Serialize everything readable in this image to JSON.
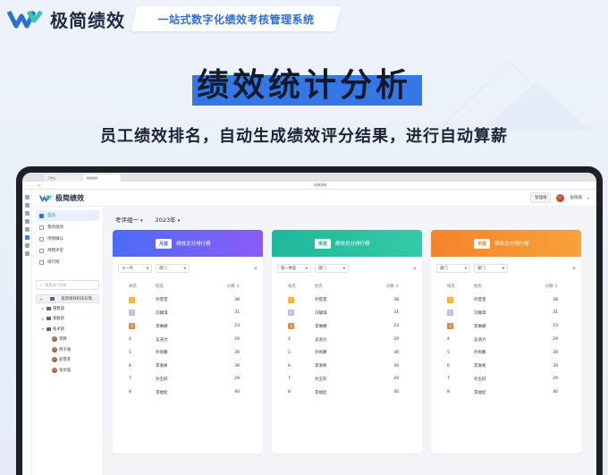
{
  "promo": {
    "brand_name": "极简绩效",
    "slogan": "一站式数字化绩效考核管理系统",
    "headline": "绩效统计分析",
    "subheadline": "员工绩效排名，自动生成绩效评分结果，进行自动算薪"
  },
  "browser": {
    "tabs": [
      "工作台",
      "极简绩效"
    ],
    "page_title": "极简绩效"
  },
  "app": {
    "name": "极简绩效",
    "admin_button": "管理端",
    "user_name": "张晓丽"
  },
  "sidebar": {
    "items": [
      {
        "label": "首页",
        "active": true
      },
      {
        "label": "我的绩效",
        "active": false
      },
      {
        "label": "待我确认",
        "active": false
      },
      {
        "label": "待我评定",
        "active": false
      },
      {
        "label": "排行榜",
        "active": false
      }
    ],
    "search_placeholder": "搜索部门名称",
    "tree": [
      {
        "label": "极简绩效科技有限...",
        "type": "org",
        "expanded": true,
        "selected": true
      },
      {
        "label": "销售部",
        "type": "dept",
        "expanded": false
      },
      {
        "label": "客服部",
        "type": "dept",
        "expanded": false
      },
      {
        "label": "技术部",
        "type": "dept",
        "expanded": true
      },
      {
        "label": "李静",
        "type": "person"
      },
      {
        "label": "周子涵",
        "type": "person"
      },
      {
        "label": "赵雪菲",
        "type": "person"
      },
      {
        "label": "张文强",
        "type": "person"
      }
    ]
  },
  "filters": {
    "group": "考评组一",
    "year": "2023年"
  },
  "colors": {
    "brand": "#3578e5",
    "month_card": [
      "#4a6cf7",
      "#8b5cf6"
    ],
    "quarter_card": [
      "#1fb89a",
      "#34c9a9"
    ],
    "year_card": [
      "#f5832a",
      "#f7a23b"
    ]
  },
  "cards": [
    {
      "tag": "月度",
      "title": "绩效总分排行榜",
      "period_select": "十一月",
      "dept_select": "部门",
      "headers": [
        "排名",
        "姓名",
        "分数"
      ],
      "rows": [
        {
          "rank": "1",
          "name": "孙芸芸",
          "score": "38"
        },
        {
          "rank": "2",
          "name": "冯靓琪",
          "score": "31"
        },
        {
          "rank": "3",
          "name": "李琳娜",
          "score": "23"
        },
        {
          "rank": "4",
          "name": "吴浩力",
          "score": "29"
        },
        {
          "rank": "5",
          "name": "孙尚鹏",
          "score": "39"
        },
        {
          "rank": "6",
          "name": "李发彬",
          "score": "39"
        },
        {
          "rank": "7",
          "name": "孙玉轩",
          "score": "29"
        },
        {
          "rank": "8",
          "name": "李福娃",
          "score": "40"
        }
      ]
    },
    {
      "tag": "季度",
      "title": "绩效总分排行榜",
      "period_select": "第一季度",
      "dept_select": "部门",
      "headers": [
        "排名",
        "姓名",
        "分数"
      ],
      "rows": [
        {
          "rank": "1",
          "name": "孙芸芸",
          "score": "38"
        },
        {
          "rank": "2",
          "name": "冯靓琪",
          "score": "31"
        },
        {
          "rank": "3",
          "name": "李琳娜",
          "score": "23"
        },
        {
          "rank": "4",
          "name": "吴浩力",
          "score": "29"
        },
        {
          "rank": "5",
          "name": "孙尚鹏",
          "score": "39"
        },
        {
          "rank": "6",
          "name": "李发彬",
          "score": "39"
        },
        {
          "rank": "7",
          "name": "孙玉轩",
          "score": "29"
        },
        {
          "rank": "8",
          "name": "李福娃",
          "score": "40"
        }
      ]
    },
    {
      "tag": "年度",
      "title": "绩效总分排行榜",
      "period_select": "部门",
      "dept_select": "部门",
      "headers": [
        "排名",
        "姓名",
        "分数"
      ],
      "rows": [
        {
          "rank": "1",
          "name": "孙芸芸",
          "score": "38"
        },
        {
          "rank": "2",
          "name": "冯靓琪",
          "score": "31"
        },
        {
          "rank": "3",
          "name": "李琳娜",
          "score": "23"
        },
        {
          "rank": "4",
          "name": "吴浩力",
          "score": "29"
        },
        {
          "rank": "5",
          "name": "孙尚鹏",
          "score": "39"
        },
        {
          "rank": "6",
          "name": "李发彬",
          "score": "39"
        },
        {
          "rank": "7",
          "name": "孙玉轩",
          "score": "29"
        },
        {
          "rank": "8",
          "name": "李福娃",
          "score": "40"
        }
      ]
    }
  ]
}
